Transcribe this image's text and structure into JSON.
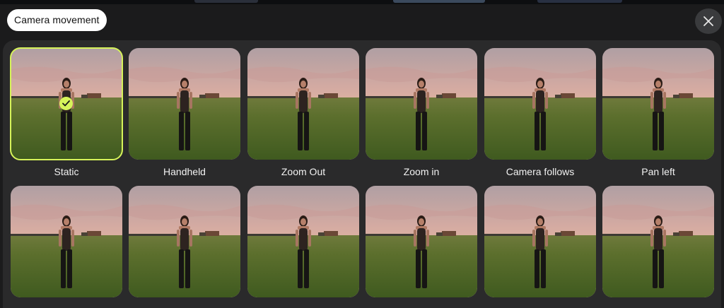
{
  "header": {
    "title": "Camera movement"
  },
  "accent_color": "#d6f35a",
  "options": [
    {
      "label": "Static",
      "selected": true
    },
    {
      "label": "Handheld",
      "selected": false
    },
    {
      "label": "Zoom Out",
      "selected": false
    },
    {
      "label": "Zoom in",
      "selected": false
    },
    {
      "label": "Camera follows",
      "selected": false
    },
    {
      "label": "Pan left",
      "selected": false
    },
    {
      "label": "",
      "selected": false
    },
    {
      "label": "",
      "selected": false
    },
    {
      "label": "",
      "selected": false
    },
    {
      "label": "",
      "selected": false
    },
    {
      "label": "",
      "selected": false
    },
    {
      "label": "",
      "selected": false
    }
  ],
  "icons": {
    "close": "close-icon",
    "selected": "checkmark-icon"
  }
}
